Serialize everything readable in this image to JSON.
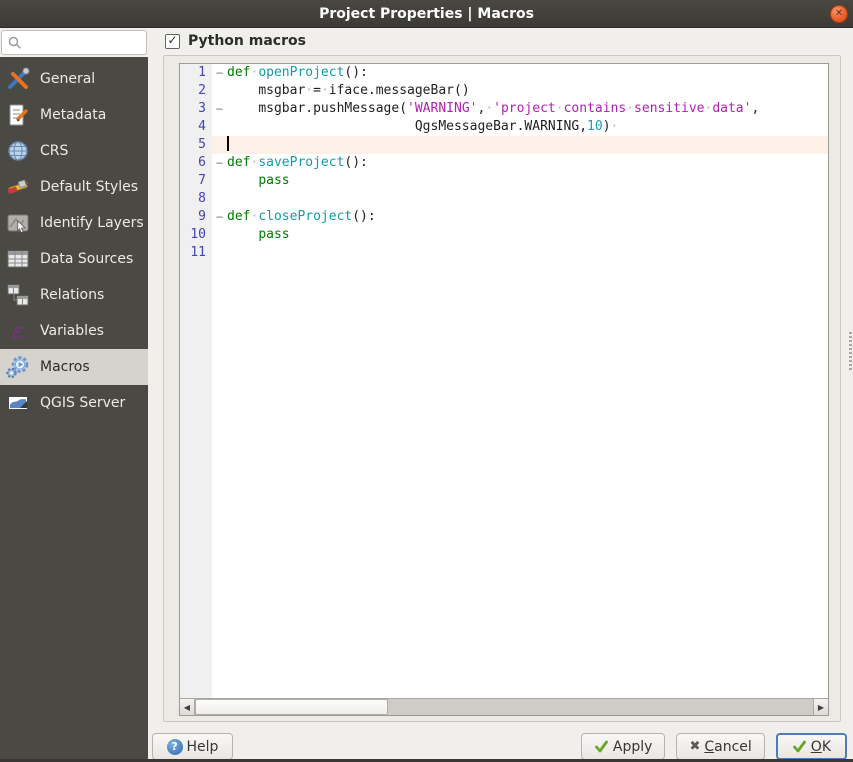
{
  "window": {
    "title": "Project Properties | Macros",
    "close_glyph": "✕"
  },
  "search": {
    "value": "",
    "placeholder": ""
  },
  "sidebar": {
    "items": [
      {
        "label": "General",
        "icon": "tools-icon",
        "selected": false
      },
      {
        "label": "Metadata",
        "icon": "metadata-icon",
        "selected": false
      },
      {
        "label": "CRS",
        "icon": "globe-icon",
        "selected": false
      },
      {
        "label": "Default Styles",
        "icon": "paintbrush-icon",
        "selected": false
      },
      {
        "label": "Identify Layers",
        "icon": "identify-icon",
        "selected": false
      },
      {
        "label": "Data Sources",
        "icon": "data-table-icon",
        "selected": false
      },
      {
        "label": "Relations",
        "icon": "relations-icon",
        "selected": false
      },
      {
        "label": "Variables",
        "icon": "epsilon-icon",
        "selected": false
      },
      {
        "label": "Macros",
        "icon": "gears-icon",
        "selected": true
      },
      {
        "label": "QGIS Server",
        "icon": "server-map-icon",
        "selected": false
      }
    ]
  },
  "main": {
    "python_macros_label": "Python macros",
    "python_macros_checked": true,
    "check_glyph": "✓"
  },
  "editor": {
    "token_colors": {
      "kw": "#007d00",
      "fn": "#1399a9",
      "str": "#b121b1",
      "num": "#17a0b3",
      "pl": "#1f1f1f"
    },
    "line_number_color": "#4343b3",
    "current_line_color": "#fcf0e7",
    "fold_glyph": "−",
    "lines": [
      {
        "n": "1",
        "fold": true,
        "tokens": [
          [
            "kw",
            "def"
          ],
          [
            "pl",
            " "
          ],
          [
            "fn",
            "openProject"
          ],
          [
            "pl",
            "():"
          ]
        ]
      },
      {
        "n": "2",
        "fold": false,
        "tokens": [
          [
            "ind",
            "    "
          ],
          [
            "pl",
            "msgbar = iface.messageBar()"
          ]
        ]
      },
      {
        "n": "3",
        "fold": true,
        "tokens": [
          [
            "ind",
            "    "
          ],
          [
            "pl",
            "msgbar.pushMessage("
          ],
          [
            "str",
            "'WARNING'"
          ],
          [
            "pl",
            ", "
          ],
          [
            "str",
            "'project contains sensitive data'"
          ],
          [
            "pl",
            ","
          ]
        ]
      },
      {
        "n": "4",
        "fold": false,
        "tokens": [
          [
            "ind",
            "                        "
          ],
          [
            "pl",
            "QgsMessageBar.WARNING,"
          ],
          [
            "num",
            "10"
          ],
          [
            "pl",
            ") "
          ]
        ]
      },
      {
        "n": "5",
        "fold": false,
        "current": true,
        "caret": true,
        "tokens": []
      },
      {
        "n": "6",
        "fold": true,
        "tokens": [
          [
            "kw",
            "def"
          ],
          [
            "pl",
            " "
          ],
          [
            "fn",
            "saveProject"
          ],
          [
            "pl",
            "():"
          ]
        ]
      },
      {
        "n": "7",
        "fold": false,
        "tokens": [
          [
            "ind",
            "    "
          ],
          [
            "kw",
            "pass"
          ]
        ]
      },
      {
        "n": "8",
        "fold": false,
        "tokens": []
      },
      {
        "n": "9",
        "fold": true,
        "tokens": [
          [
            "kw",
            "def"
          ],
          [
            "pl",
            " "
          ],
          [
            "fn",
            "closeProject"
          ],
          [
            "pl",
            "():"
          ]
        ]
      },
      {
        "n": "10",
        "fold": false,
        "tokens": [
          [
            "ind",
            "    "
          ],
          [
            "kw",
            "pass"
          ]
        ]
      },
      {
        "n": "11",
        "fold": false,
        "tokens": []
      }
    ]
  },
  "scrollbar": {
    "left_arrow": "◀",
    "right_arrow": "▶"
  },
  "buttons": {
    "help": "Help",
    "apply": "Apply",
    "cancel": {
      "pre": "C",
      "rest": "ancel"
    },
    "ok": {
      "pre": "O",
      "rest": "K"
    }
  },
  "colors": {
    "titlebar": "#3d3b36",
    "close_button": "#ea5420",
    "sidebar_bg": "#4b4944",
    "sidebar_selected_bg": "#d6d2cc",
    "ok_focus_border": "#4e7cb8",
    "check_green": "#65a829"
  }
}
